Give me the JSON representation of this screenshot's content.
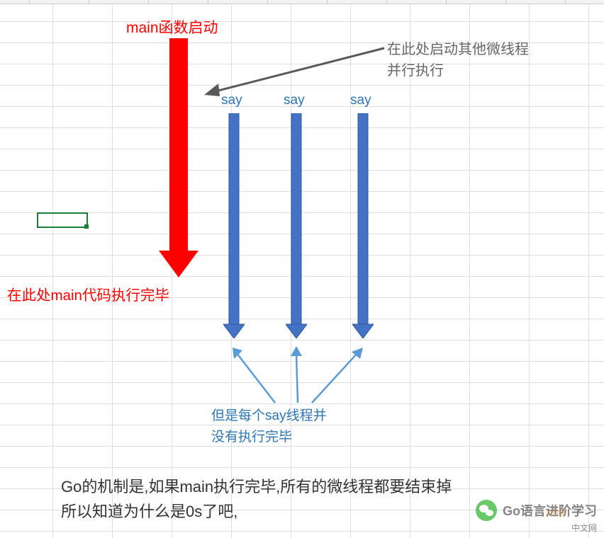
{
  "diagram": {
    "main_title": "main函数启动",
    "main_done": "在此处main代码执行完毕",
    "dark_note_line1": "在此处启动其他微线程",
    "dark_note_line2": "并行执行",
    "say_label_1": "say",
    "say_label_2": "say",
    "say_label_3": "say",
    "blue_note_line1": "但是每个say线程并",
    "blue_note_line2": "没有执行完毕",
    "bottom_line1": "Go的机制是,如果main执行完毕,所有的微线程都要结束掉",
    "bottom_line2": "所以知道为什么是0s了吧,"
  },
  "watermark": {
    "text": "Go语言进阶学习",
    "sub": "中文网",
    "php": "php"
  },
  "colors": {
    "red": "#ff0000",
    "blue_text": "#2e75b6",
    "blue_arrow": "#4472c4",
    "blue_arrow_stroke": "#2f5597",
    "dark_arrow": "#595959",
    "light_blue": "#5b9bd5"
  },
  "chart_data": {
    "type": "diagram",
    "description": "Goroutine execution flow showing main function and parallel say goroutines",
    "arrows": [
      {
        "name": "main-red-arrow",
        "from": "main函数启动",
        "to": "main代码执行完毕",
        "color": "red",
        "direction": "down"
      },
      {
        "name": "say-arrow-1",
        "label": "say",
        "color": "blue",
        "direction": "down"
      },
      {
        "name": "say-arrow-2",
        "label": "say",
        "color": "blue",
        "direction": "down"
      },
      {
        "name": "say-arrow-3",
        "label": "say",
        "color": "blue",
        "direction": "down"
      },
      {
        "name": "dark-pointer",
        "from": "启动其他微线程注释",
        "to": "say起点",
        "color": "dark-gray"
      },
      {
        "name": "blue-pointer-1",
        "from": "say线程注释",
        "to": "say-arrow-1-end",
        "color": "light-blue"
      },
      {
        "name": "blue-pointer-2",
        "from": "say线程注释",
        "to": "say-arrow-2-end",
        "color": "light-blue"
      },
      {
        "name": "blue-pointer-3",
        "from": "say线程注释",
        "to": "say-arrow-3-end",
        "color": "light-blue"
      }
    ]
  }
}
